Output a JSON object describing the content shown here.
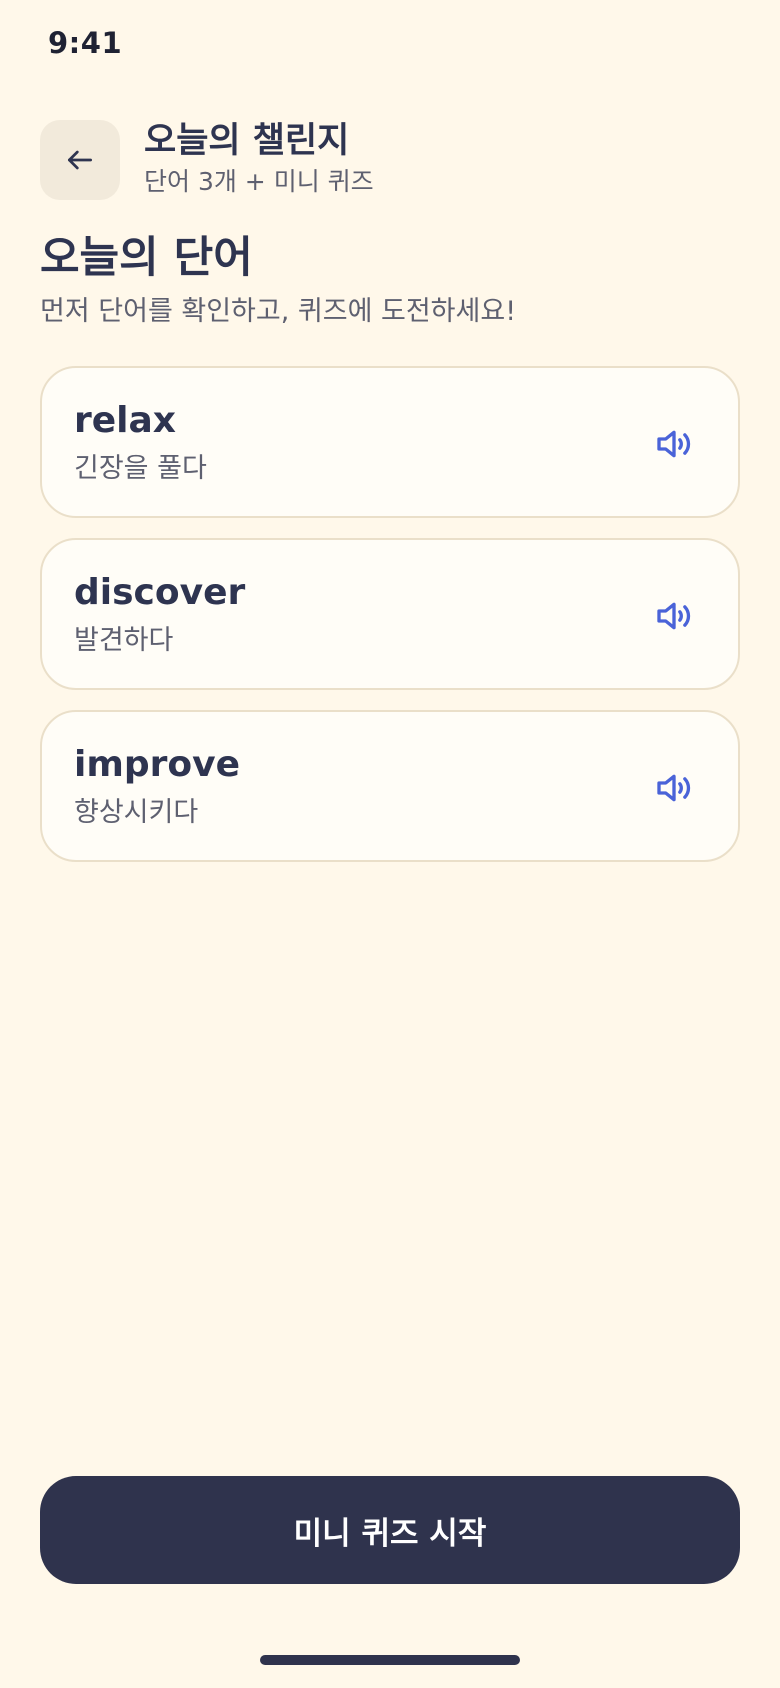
{
  "status_bar": {
    "time": "9:41"
  },
  "header": {
    "back_icon": "arrow-left-icon",
    "title": "오늘의 챌린지",
    "subtitle": "단어 3개 + 미니 퀴즈"
  },
  "section": {
    "title": "오늘의 단어",
    "description": "먼저 단어를 확인하고, 퀴즈에 도전하세요!"
  },
  "words": [
    {
      "term": "relax",
      "meaning": "긴장을 풀다",
      "icon": "speaker-icon"
    },
    {
      "term": "discover",
      "meaning": "발견하다",
      "icon": "speaker-icon"
    },
    {
      "term": "improve",
      "meaning": "향상시키다",
      "icon": "speaker-icon"
    }
  ],
  "start_button": {
    "label": "미니 퀴즈 시작"
  },
  "colors": {
    "background": "#FFF8EA",
    "primary": "#2F334D",
    "accent": "#4A63D8",
    "card_border": "#EADFC9"
  }
}
